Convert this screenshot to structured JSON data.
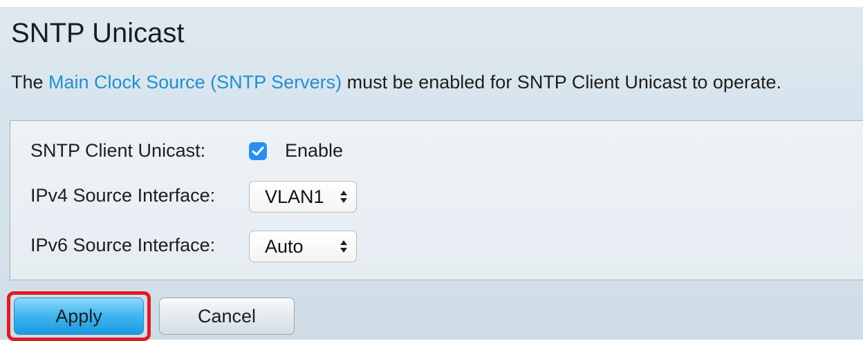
{
  "header": {
    "title": "SNTP Unicast"
  },
  "notice": {
    "prefix": "The ",
    "link_text": "Main Clock Source (SNTP Servers)",
    "suffix": " must be enabled for SNTP Client Unicast to operate."
  },
  "form": {
    "client_unicast_label": "SNTP Client Unicast:",
    "enable_label": "Enable",
    "enable_checked": true,
    "ipv4_label": "IPv4 Source Interface:",
    "ipv4_value": "VLAN1",
    "ipv6_label": "IPv6 Source Interface:",
    "ipv6_value": "Auto"
  },
  "actions": {
    "apply_label": "Apply",
    "cancel_label": "Cancel",
    "highlight_color": "#e01b22"
  },
  "colors": {
    "link": "#1f8fd0",
    "checkbox": "#2a8df2",
    "apply_button": "#3fb4ee"
  }
}
